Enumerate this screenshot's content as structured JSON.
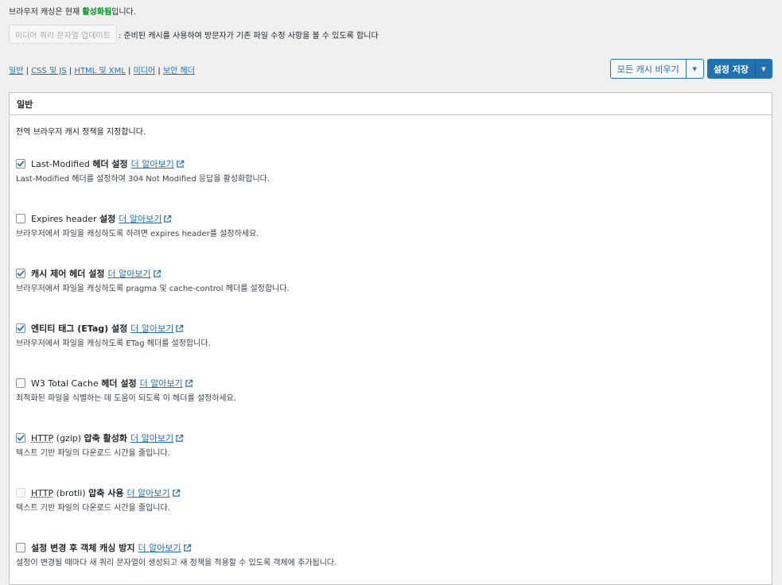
{
  "status": {
    "prefix": "브라우저 캐싱은 현재 ",
    "state": "활성화됨",
    "suffix": "입니다."
  },
  "update": {
    "button_label": "미디어 쿼리 문자열 업데이트",
    "description": ": 준비된 캐시를 사용하여 방문자가 기존 파일 수정 사항을 볼 수 있도록 합니다"
  },
  "nav": {
    "general": "일반",
    "css_js": "CSS 및 JS",
    "html_xml": "HTML 및 XML",
    "media": "미디어",
    "security": "보안 헤더",
    "sep": " | "
  },
  "toolbar": {
    "empty_caches": "모든 캐시 비우기",
    "save_settings": "설정 저장",
    "caret": "▼"
  },
  "panel": {
    "title": "일반",
    "description": "전역 브라우저 캐시 정책을 지정합니다.",
    "more_label": "더 알아보기",
    "options": [
      {
        "checked": true,
        "disabled": false,
        "label_plain": "Last-Modified ",
        "label_bold": "헤더 설정",
        "description": "Last-Modified 헤더를 설정하여 304 Not Modified 응답을 활성화합니다."
      },
      {
        "checked": false,
        "disabled": false,
        "label_plain": "Expires header ",
        "label_bold": "설정",
        "description": "브라우저에서 파일을 캐싱하도록 하려면 expires header를 설정하세요."
      },
      {
        "checked": true,
        "disabled": false,
        "label_plain": "",
        "label_bold": "캐시 제어 헤더 설정",
        "description": "브라우저에서 파일을 캐싱하도록 pragma 및 cache-control 헤더를 설정합니다."
      },
      {
        "checked": true,
        "disabled": false,
        "label_plain": "",
        "label_bold": "엔티티 태그 (ETag) 설정",
        "description": "브라우저에서 파일을 캐싱하도록 ETag 헤더를 설정합니다."
      },
      {
        "checked": false,
        "disabled": false,
        "label_plain": "W3 Total Cache ",
        "label_bold": "헤더 설정",
        "description": "최적화된 파일을 식별하는 데 도움이 되도록 이 헤더를 설정하세요."
      },
      {
        "checked": true,
        "disabled": false,
        "label_abbr": "HTTP",
        "label_plain": " (gzip) ",
        "label_bold": "압축 활성화",
        "description": "텍스트 기반 파일의 다운로드 시간을 줄입니다."
      },
      {
        "checked": false,
        "disabled": true,
        "label_abbr": "HTTP",
        "label_plain": " (brotli) ",
        "label_bold": "압축 사용",
        "description": "텍스트 기반 파일의 다운로드 시간을 줄입니다."
      },
      {
        "checked": false,
        "disabled": false,
        "label_plain": "",
        "label_bold": "설정 변경 후 객체 캐싱 방지",
        "description": "설정이 변경될 때마다 새 쿼리 문자열이 생성되고 새 정책을 적용할 수 있도록 객체에 추가됩니다."
      }
    ]
  },
  "icons": {
    "external": "external-link-icon",
    "check": "checkmark-icon"
  },
  "colors": {
    "link": "#2271b1",
    "active": "#008a20",
    "primary": "#2271b1"
  }
}
